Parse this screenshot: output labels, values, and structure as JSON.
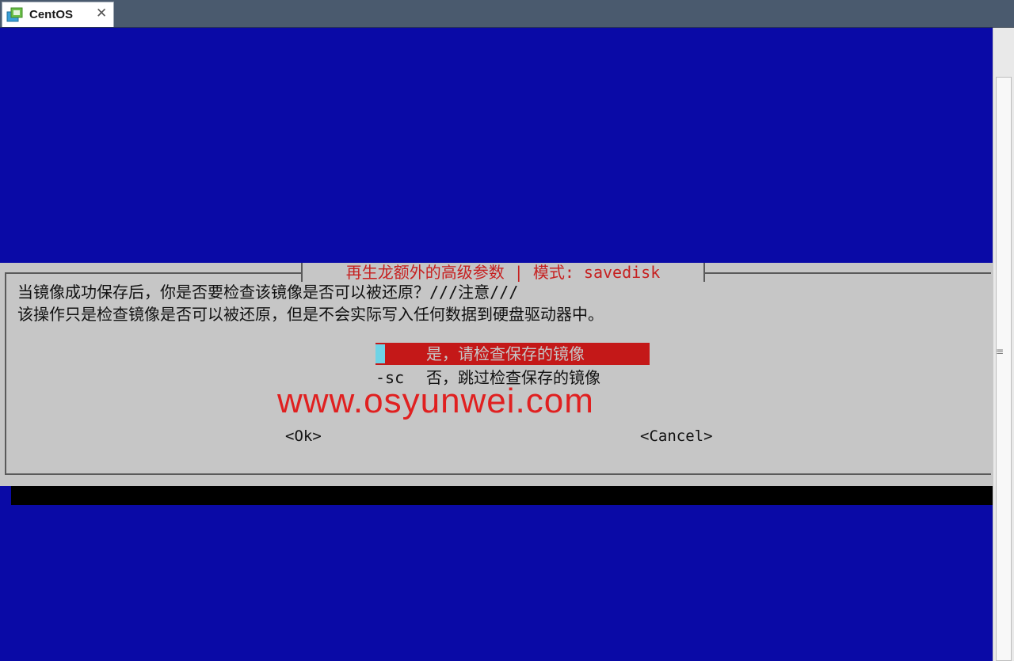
{
  "tab": {
    "title": "CentOS",
    "close_glyph": "✕",
    "icon": "vm-icon"
  },
  "dialog": {
    "title": "再生龙额外的高级参数 | 模式: savedisk",
    "message_line1": "当镜像成功保存后，你是否要检查该镜像是否可以被还原？///注意///",
    "message_line2": "该操作只是检查镜像是否可以被还原，但是不会实际写入任何数据到硬盘驱动器中。",
    "options": [
      {
        "tag": "",
        "label": "是，请检查保存的镜像",
        "selected": true
      },
      {
        "tag": "-sc",
        "label": "否，跳过检查保存的镜像",
        "selected": false
      }
    ],
    "ok_label": "<Ok>",
    "cancel_label": "<Cancel>"
  },
  "watermark": "www.osyunwei.com",
  "colors": {
    "console_background": "#0a0aa6",
    "dialog_background": "#c6c6c6",
    "accent_red": "#c41818",
    "cursor": "#6fd3e6"
  }
}
